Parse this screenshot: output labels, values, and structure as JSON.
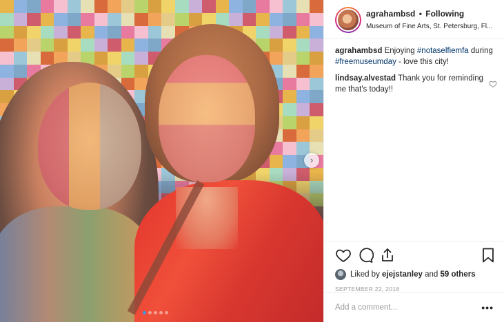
{
  "post": {
    "media": {
      "description_icon": "photo",
      "carousel_dots": 5,
      "carousel_active_index": 0,
      "next_icon": "chevron-right-icon",
      "mosaic_colors": [
        "#e8b44c",
        "#d86a3c",
        "#c9b0d8",
        "#9cc7d8",
        "#f0d46a",
        "#e87aa0",
        "#b9d46a",
        "#8fb3e0",
        "#f2a45a",
        "#cf5c6c",
        "#e6e0b4",
        "#a8dcc0",
        "#f6c0d0",
        "#d8a040",
        "#7fa8c8",
        "#e4cc88"
      ]
    },
    "header": {
      "username": "agrahambsd",
      "separator": "•",
      "follow_status": "Following",
      "location": "Museum of Fine Arts, St. Petersburg, Fl..."
    },
    "caption": {
      "username": "agrahambsd",
      "text_before": "Enjoying ",
      "hashtag1": "#notaselfiemfa",
      "text_middle": " during ",
      "hashtag2": "#freemuseumday",
      "text_after": " - love this city!"
    },
    "comment": {
      "username": "lindsay.alvestad",
      "text": "Thank you for reminding me that's today!!",
      "like_icon": "heart-outline-icon"
    },
    "actions": {
      "like_icon": "heart-outline-icon",
      "comment_icon": "comment-bubble-icon",
      "share_icon": "share-upload-icon",
      "save_icon": "bookmark-icon"
    },
    "likes": {
      "prefix": "Liked by",
      "user": "ejejstanley",
      "joiner": "and",
      "others": "59 others"
    },
    "date": "SEPTEMBER 22, 2018",
    "add_comment": {
      "placeholder": "Add a comment...",
      "more": "•••"
    }
  }
}
